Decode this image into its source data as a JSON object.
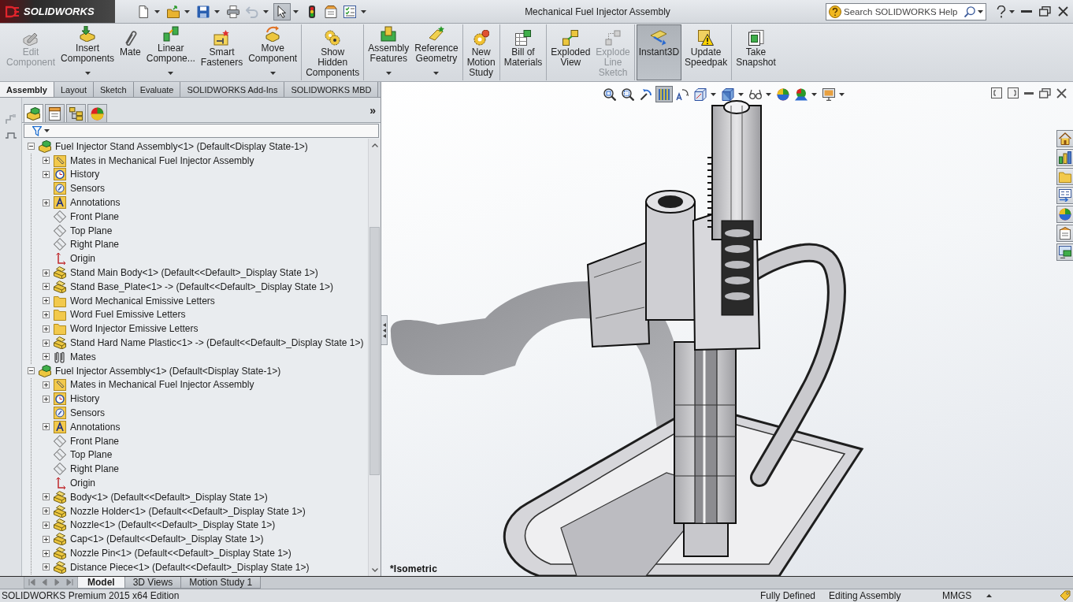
{
  "title_bar": {
    "logo": "SOLIDWORKS",
    "title": "Mechanical Fuel Injector Assembly",
    "search": {
      "placeholder": "Search SOLIDWORKS Help"
    }
  },
  "quick_access": [
    {
      "kind": "new",
      "has_menu": true,
      "disabled": false,
      "selected": false
    },
    {
      "kind": "open",
      "has_menu": true,
      "disabled": false,
      "selected": false
    },
    {
      "kind": "save",
      "has_menu": true,
      "disabled": false,
      "selected": false
    },
    {
      "kind": "print",
      "has_menu": false,
      "disabled": false,
      "selected": false
    },
    {
      "kind": "undo",
      "has_menu": true,
      "disabled": true,
      "selected": false
    },
    {
      "kind": "select",
      "has_menu": true,
      "disabled": false,
      "selected": true
    },
    {
      "kind": "rebuild",
      "has_menu": false,
      "disabled": false,
      "selected": false
    },
    {
      "kind": "options",
      "has_menu": false,
      "disabled": false,
      "selected": false
    },
    {
      "kind": "customize",
      "has_menu": true,
      "disabled": false,
      "selected": false
    }
  ],
  "ribbon": {
    "groups": [
      {
        "buttons": [
          {
            "label": "Edit Component",
            "kind": "edit-component",
            "has_menu": false,
            "disabled": true,
            "selected": false
          },
          {
            "label": "Insert Components",
            "kind": "insert-components",
            "has_menu": true,
            "disabled": false,
            "selected": false
          },
          {
            "label": "Mate",
            "kind": "mate",
            "has_menu": false,
            "disabled": false,
            "selected": false
          },
          {
            "label": "Linear Compone...",
            "kind": "linear-pattern",
            "has_menu": true,
            "disabled": false,
            "selected": false
          },
          {
            "label": "Smart Fasteners",
            "kind": "smart-fasteners",
            "has_menu": false,
            "disabled": false,
            "selected": false
          },
          {
            "label": "Move Component",
            "kind": "move-component",
            "has_menu": true,
            "disabled": false,
            "selected": false
          }
        ]
      },
      {
        "buttons": [
          {
            "label": "Show Hidden Components",
            "kind": "show-hidden",
            "has_menu": false,
            "disabled": false,
            "selected": false
          }
        ]
      },
      {
        "buttons": [
          {
            "label": "Assembly Features",
            "kind": "assembly-features",
            "has_menu": true,
            "disabled": false,
            "selected": false
          },
          {
            "label": "Reference Geometry",
            "kind": "reference-geometry",
            "has_menu": true,
            "disabled": false,
            "selected": false
          }
        ]
      },
      {
        "buttons": [
          {
            "label": "New Motion Study",
            "kind": "motion-study",
            "has_menu": false,
            "disabled": false,
            "selected": false
          }
        ]
      },
      {
        "buttons": [
          {
            "label": "Bill of Materials",
            "kind": "bill-of-materials",
            "has_menu": false,
            "disabled": false,
            "selected": false
          }
        ]
      },
      {
        "buttons": [
          {
            "label": "Exploded View",
            "kind": "exploded-view",
            "has_menu": false,
            "disabled": false,
            "selected": false
          },
          {
            "label": "Explode Line Sketch",
            "kind": "explode-line-sketch",
            "has_menu": false,
            "disabled": true,
            "selected": false
          }
        ]
      },
      {
        "buttons": [
          {
            "label": "Instant3D",
            "kind": "instant3d",
            "has_menu": false,
            "disabled": false,
            "selected": true
          },
          {
            "label": "Update Speedpak",
            "kind": "update-speedpak",
            "has_menu": false,
            "disabled": false,
            "selected": false
          }
        ]
      },
      {
        "buttons": [
          {
            "label": "Take Snapshot",
            "kind": "take-snapshot",
            "has_menu": false,
            "disabled": false,
            "selected": false
          }
        ]
      }
    ]
  },
  "ribbon_tabs": [
    {
      "label": "Assembly",
      "selected": true
    },
    {
      "label": "Layout",
      "selected": false
    },
    {
      "label": "Sketch",
      "selected": false
    },
    {
      "label": "Evaluate",
      "selected": false
    },
    {
      "label": "SOLIDWORKS Add-Ins",
      "selected": false
    },
    {
      "label": "SOLIDWORKS MBD",
      "selected": false
    }
  ],
  "feature_manager": {
    "panel_tabs": [
      {
        "kind": "feature-tree",
        "selected": true
      },
      {
        "kind": "property-manager",
        "selected": false
      },
      {
        "kind": "configuration-manager",
        "selected": false
      },
      {
        "kind": "display-manager",
        "selected": false
      }
    ],
    "expand_symbol": "»",
    "tree": [
      {
        "label": "Fuel Injector Stand Assembly<1> (Default<Display State-1>)",
        "kind": "assembly",
        "expanded": true,
        "children": [
          {
            "label": "Mates in Mechanical Fuel Injector Assembly",
            "kind": "mates-folder",
            "expanded": false
          },
          {
            "label": "History",
            "kind": "history",
            "expanded": false
          },
          {
            "label": "Sensors",
            "kind": "sensors"
          },
          {
            "label": "Annotations",
            "kind": "annotations",
            "expanded": false
          },
          {
            "label": "Front Plane",
            "kind": "plane"
          },
          {
            "label": "Top Plane",
            "kind": "plane"
          },
          {
            "label": "Right Plane",
            "kind": "plane"
          },
          {
            "label": "Origin",
            "kind": "origin"
          },
          {
            "label": "Stand Main Body<1> (Default<<Default>_Display State 1>)",
            "kind": "part",
            "expanded": false
          },
          {
            "label": "Stand Base_Plate<1> -> (Default<<Default>_Display State 1>)",
            "kind": "part",
            "expanded": false
          },
          {
            "label": "Word Mechanical Emissive Letters",
            "kind": "folder",
            "expanded": false
          },
          {
            "label": "Word Fuel Emissive Letters",
            "kind": "folder",
            "expanded": false
          },
          {
            "label": "Word Injector Emissive Letters",
            "kind": "folder",
            "expanded": false
          },
          {
            "label": "Stand Hard Name Plastic<1> -> (Default<<Default>_Display State 1>)",
            "kind": "part",
            "expanded": false
          },
          {
            "label": "Mates",
            "kind": "mates",
            "expanded": false
          }
        ]
      },
      {
        "label": "Fuel Injector Assembly<1> (Default<Display State-1>)",
        "kind": "assembly",
        "expanded": true,
        "children": [
          {
            "label": "Mates in Mechanical Fuel Injector Assembly",
            "kind": "mates-folder",
            "expanded": false
          },
          {
            "label": "History",
            "kind": "history",
            "expanded": false
          },
          {
            "label": "Sensors",
            "kind": "sensors"
          },
          {
            "label": "Annotations",
            "kind": "annotations",
            "expanded": false
          },
          {
            "label": "Front Plane",
            "kind": "plane"
          },
          {
            "label": "Top Plane",
            "kind": "plane"
          },
          {
            "label": "Right Plane",
            "kind": "plane"
          },
          {
            "label": "Origin",
            "kind": "origin"
          },
          {
            "label": "Body<1> (Default<<Default>_Display State 1>)",
            "kind": "part",
            "expanded": false
          },
          {
            "label": "Nozzle Holder<1> (Default<<Default>_Display State 1>)",
            "kind": "part",
            "expanded": false
          },
          {
            "label": "Nozzle<1> (Default<<Default>_Display State 1>)",
            "kind": "part",
            "expanded": false
          },
          {
            "label": "Cap<1> (Default<<Default>_Display State 1>)",
            "kind": "part",
            "expanded": false
          },
          {
            "label": "Nozzle Pin<1> (Default<<Default>_Display State 1>)",
            "kind": "part",
            "expanded": false
          },
          {
            "label": "Distance Piece<1> (Default<<Default>_Display State 1>)",
            "kind": "part",
            "expanded": false
          }
        ]
      }
    ]
  },
  "viewport": {
    "view_toolbar": [
      {
        "kind": "zoom-fit",
        "has_menu": false,
        "selected": false
      },
      {
        "kind": "zoom-area",
        "has_menu": false,
        "selected": false
      },
      {
        "kind": "previous-view",
        "has_menu": false,
        "selected": false
      },
      {
        "kind": "section-view",
        "has_menu": false,
        "selected": true
      },
      {
        "kind": "dynamic-annotation",
        "has_menu": false,
        "selected": false
      },
      {
        "kind": "view-orientation",
        "has_menu": true,
        "selected": false
      },
      {
        "kind": "display-style",
        "has_menu": true,
        "selected": false
      },
      {
        "kind": "hide-show",
        "has_menu": true,
        "selected": false
      },
      {
        "kind": "edit-appearance",
        "has_menu": false,
        "selected": false
      },
      {
        "kind": "apply-scene",
        "has_menu": true,
        "selected": false
      },
      {
        "kind": "view-settings",
        "has_menu": true,
        "selected": false
      }
    ],
    "view_label": "*Isometric"
  },
  "bottom_tabs": [
    {
      "label": "Model",
      "selected": true
    },
    {
      "label": "3D Views",
      "selected": false
    },
    {
      "label": "Motion Study 1",
      "selected": false
    }
  ],
  "status_bar": {
    "edition": "SOLIDWORKS Premium 2015 x64 Edition",
    "state": "Fully Defined",
    "mode": "Editing Assembly",
    "units": "MMGS"
  }
}
